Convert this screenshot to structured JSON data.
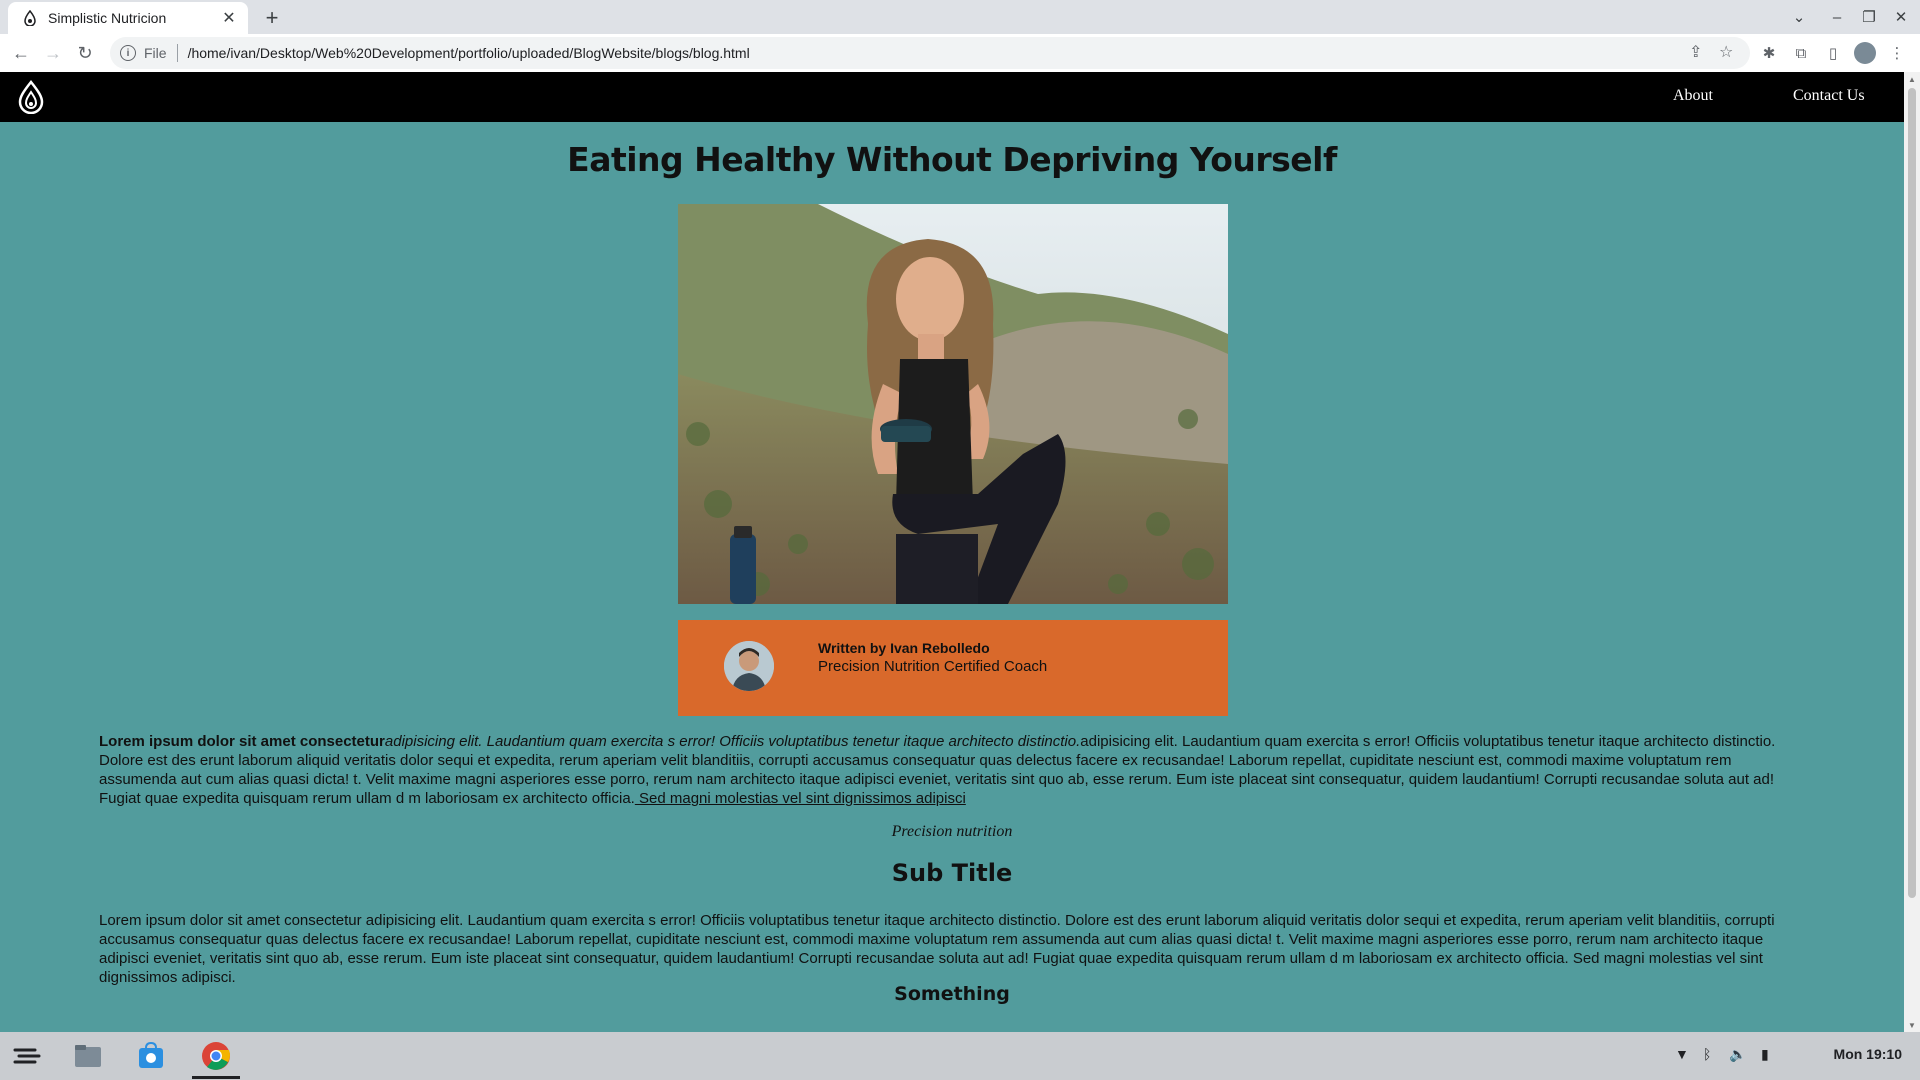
{
  "browser": {
    "tab_title": "Simplistic Nutricion",
    "tab_close": "✕",
    "new_tab": "+",
    "url_scheme": "File",
    "url": "/home/ivan/Desktop/Web%20Development/portfolio/uploaded/BlogWebsite/blogs/blog.html"
  },
  "site": {
    "nav": {
      "about": "About",
      "contact": "Contact Us"
    },
    "article": {
      "title": "Eating Healthy Without Depriving Yourself",
      "author_name": "Written by Ivan Rebolledo",
      "author_role": "Precision Nutrition Certified Coach",
      "intro_bold": "Lorem ipsum dolor sit amet consectetur",
      "intro_italic": "adipisicing elit. Laudantium quam exercita s error! Officiis voluptatibus tenetur itaque architecto distinctio.",
      "intro_body": "adipisicing elit. Laudantium quam exercita s error! Officiis voluptatibus tenetur itaque architecto distinctio. Dolore est des erunt laborum aliquid veritatis dolor sequi et expedita, rerum aperiam velit blanditiis, corrupti accusamus consequatur quas delectus facere ex recusandae! Laborum repellat, cupiditate nesciunt est, commodi maxime voluptatum rem assumenda aut cum alias quasi dicta! t. Velit maxime magni asperiores esse porro, rerum nam architecto itaque adipisci eveniet, veritatis sint quo ab, esse rerum. Eum iste placeat sint consequatur, quidem laudantium! Corrupti recusandae soluta aut ad! Fugiat quae expedita quisquam rerum ullam d m laboriosam ex architecto officia.",
      "intro_link": " Sed magni molestias vel sint dignissimos adipisci",
      "image_caption": "Precision nutrition",
      "subtitle": "Sub Title",
      "body_paragraph": "Lorem ipsum dolor sit amet consectetur adipisicing elit. Laudantium quam exercita s error! Officiis voluptatibus tenetur itaque architecto distinctio. Dolore est des erunt laborum aliquid veritatis dolor sequi et expedita, rerum aperiam velit blanditiis, corrupti accusamus consequatur quas delectus facere ex recusandae! Laborum repellat, cupiditate nesciunt est, commodi maxime voluptatum rem assumenda aut cum alias quasi dicta! t. Velit maxime magni asperiores esse porro, rerum nam architecto itaque adipisci eveniet, veritatis sint quo ab, esse rerum. Eum iste placeat sint consequatur, quidem laudantium! Corrupti recusandae soluta aut ad! Fugiat quae expedita quisquam rerum ullam d m laboriosam ex architecto officia. Sed magni molestias vel sint dignissimos adipisci.",
      "section_title": "Something"
    }
  },
  "taskbar": {
    "clock": "Mon 19:10"
  },
  "colors": {
    "page_bg": "#529c9d",
    "nav_bg": "#000000",
    "author_box": "#d9692b"
  }
}
